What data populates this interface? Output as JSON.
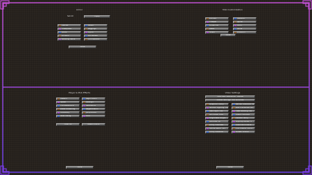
{
  "panes": {
    "top_left": {
      "title": "Armor",
      "stat_label": "Sell All",
      "accept_label": "Equip",
      "buttons": [
        {
          "label": "Helmet",
          "icon": "helmet-icon"
        },
        {
          "label": "Shield",
          "icon": "shield-icon"
        },
        {
          "label": "Chestplate",
          "icon": "chestplate-icon"
        },
        {
          "label": "Leggings",
          "icon": "leggings-icon"
        },
        {
          "label": "Boots",
          "icon": "boots-icon"
        },
        {
          "label": "Elytra",
          "icon": "elytra-icon"
        },
        {
          "label": "Offhand",
          "icon": "offhand-icon"
        },
        {
          "label": "Enchanted",
          "icon": "enchant-icon"
        },
        {
          "label": "Mending Items",
          "icon": "mending-icon"
        },
        {
          "label": "Trim Options",
          "icon": "trim-icon"
        }
      ],
      "done_label": "Done"
    },
    "top_right": {
      "title": "Mob Customization",
      "buttons": [
        {
          "label": "Zombie",
          "icon": "zombie-icon"
        },
        {
          "label": "Skeleton",
          "icon": "skeleton-icon"
        },
        {
          "label": "Creeper",
          "icon": "creeper-icon"
        },
        {
          "label": "Spider",
          "icon": "spider-icon"
        },
        {
          "label": "Enderman",
          "icon": "enderman-icon"
        },
        {
          "label": "Witch",
          "icon": "witch-icon"
        },
        {
          "label": "Blaze",
          "icon": "blaze-icon"
        },
        {
          "label": "Slime",
          "icon": "slime-icon"
        },
        {
          "label": "Ghast",
          "icon": "ghast-icon"
        },
        {
          "label": "Phantom",
          "icon": "phantom-icon"
        }
      ],
      "done_label": "Done"
    },
    "bottom_left": {
      "title": "Player & Mob Effects",
      "buttons": [
        {
          "label": "Haste II",
          "icon": "haste-icon"
        },
        {
          "label": "Night Vision",
          "icon": "night-vision-icon"
        },
        {
          "label": "Speed",
          "icon": "speed-icon"
        },
        {
          "label": "Strength",
          "icon": "strength-icon"
        },
        {
          "label": "Fire Resistance",
          "icon": "fire-res-icon"
        },
        {
          "label": "Resistance",
          "icon": "resistance-icon"
        },
        {
          "label": "Water Breathing",
          "icon": "water-breathing-icon"
        },
        {
          "label": "Regeneration",
          "icon": "regeneration-icon"
        },
        {
          "label": "Invisibility",
          "icon": "invisibility-icon"
        },
        {
          "label": "Jump Boost",
          "icon": "jump-icon"
        },
        {
          "label": "Slow Falling",
          "icon": "slow-falling-icon"
        },
        {
          "label": "Luck",
          "icon": "luck-icon"
        }
      ],
      "extra_buttons": [
        "Clear All",
        "Reset Effects"
      ],
      "done_label": "Done"
    },
    "bottom_right": {
      "title": "Video Settings",
      "top_buttons": [
        "Fullscreen Resolution: Default",
        "Mouse Settings: 4x4 Accurate"
      ],
      "buttons": [
        {
          "label": "Graphics: Fancy",
          "icon": "graphics-icon"
        },
        {
          "label": "Render Distance: 12",
          "icon": "render-icon"
        },
        {
          "label": "Smooth Lighting: ON",
          "icon": "lighting-icon"
        },
        {
          "label": "Max Framerate: 60",
          "icon": "framerate-icon"
        },
        {
          "label": "Use VSync: ON",
          "icon": "vsync-icon"
        },
        {
          "label": "View Bobbing: ON",
          "icon": "bobbing-icon"
        },
        {
          "label": "GUI Scale: Auto",
          "icon": "gui-scale-icon"
        },
        {
          "label": "Attack Indicator",
          "icon": "attack-icon"
        },
        {
          "label": "Brightness: Bright",
          "icon": "brightness-icon"
        },
        {
          "label": "Clouds: Fancy",
          "icon": "clouds-icon"
        },
        {
          "label": "Particles: All",
          "icon": "particles-icon"
        },
        {
          "label": "Mipmap Levels: 4",
          "icon": "mipmap-icon"
        },
        {
          "label": "Entity Shadows",
          "icon": "shadows-icon"
        },
        {
          "label": "Distortion Effects",
          "icon": "distortion-icon"
        },
        {
          "label": "Biome Blend: 5x5",
          "icon": "biome-icon"
        },
        {
          "label": "FOV Effects: 100%",
          "icon": "fov-icon"
        },
        {
          "label": "Entity Distance",
          "icon": "entity-distance-icon"
        },
        {
          "label": "Screen Effects",
          "icon": "screen-effects-icon"
        }
      ],
      "done_label": "Done"
    }
  },
  "colors": {
    "border_top": "#b04bd0",
    "border_bottom": "#7a3be0",
    "button": "#6e6e6e",
    "background": "#2a2520"
  }
}
